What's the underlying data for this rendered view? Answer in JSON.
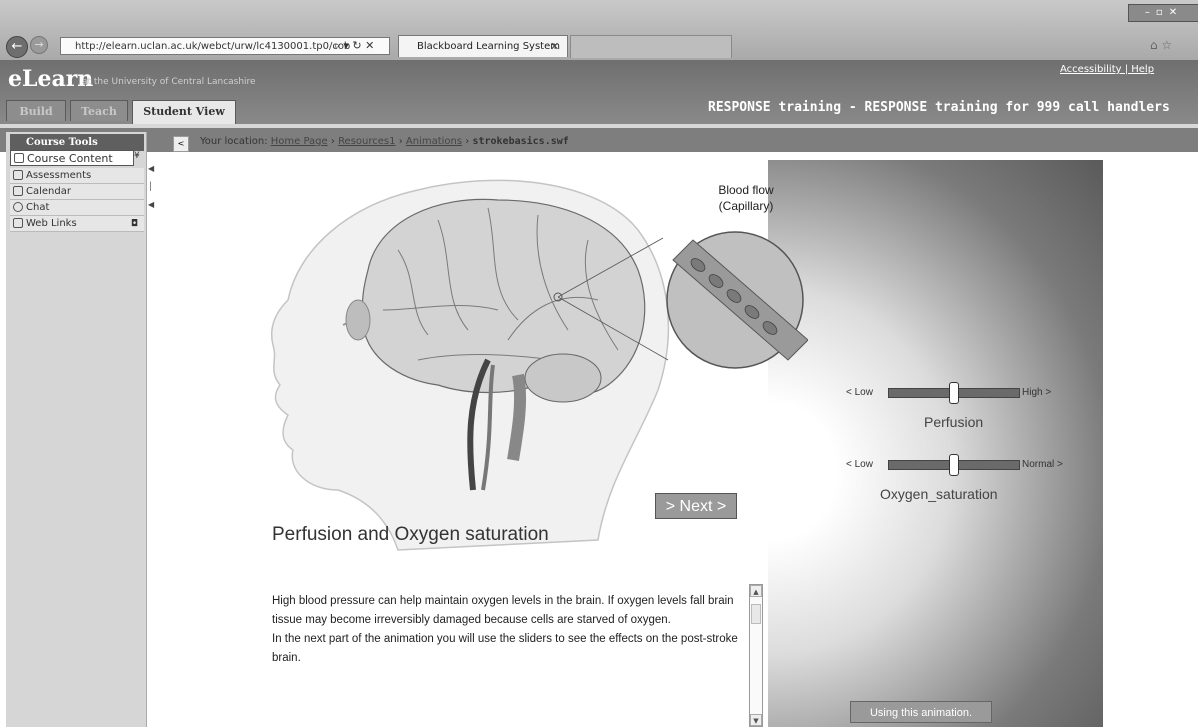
{
  "browser": {
    "url": "http://elearn.uclan.ac.uk/webct/urw/lc4130001.tp0/cob",
    "address_tools": "⌕ ▾ ↻ ✕",
    "tab_title": "Blackboard Learning System",
    "tab_close": "✕"
  },
  "header": {
    "logo": "eLearn",
    "logo_sub": "at the University of Central Lancashire",
    "links": "Accessibility | Help",
    "tabs": [
      "Build",
      "Teach",
      "Student View"
    ],
    "course_title": "RESPONSE training - RESPONSE training for 999 call handlers"
  },
  "sidebar": {
    "heading": "Course Tools",
    "items": [
      {
        "label": "Course Content",
        "icon": "home-icon"
      },
      {
        "label": "Assessments",
        "icon": "clipboard-icon"
      },
      {
        "label": "Calendar",
        "icon": "calendar-icon"
      },
      {
        "label": "Chat",
        "icon": "chat-bubble-icon"
      },
      {
        "label": "Web Links",
        "icon": "link-icon"
      }
    ]
  },
  "breadcrumb": {
    "prefix": "Your location:",
    "links": [
      "Home Page",
      "Resources1",
      "Animations"
    ],
    "current": "strokebasics.swf",
    "separator": "›"
  },
  "animation": {
    "blood_flow_label": "Blood flow\n(Capillary)",
    "sliders": [
      {
        "name": "Perfusion",
        "low": "< Low",
        "high": "High >",
        "level": 0.5
      },
      {
        "name": "Oxygen_saturation",
        "low": "< Low",
        "high": "Normal >",
        "level": 0.5
      }
    ],
    "next_label": "> Next >",
    "title": "Perfusion and Oxygen saturation",
    "body": "High blood pressure can help maintain oxygen levels in the brain. If oxygen levels fall brain tissue may become irreversibly damaged because cells are starved of oxygen.\n In the next part of the animation you will use the sliders to see the effects on the post-stroke brain.",
    "help_button": "Using this animation."
  }
}
